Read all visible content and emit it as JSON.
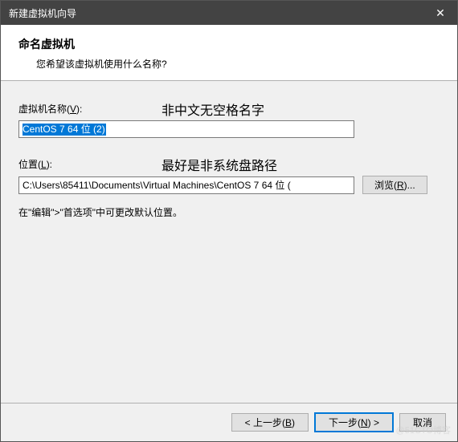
{
  "window": {
    "title": "新建虚拟机向导"
  },
  "header": {
    "title": "命名虚拟机",
    "subtitle": "您希望该虚拟机使用什么名称?"
  },
  "nameField": {
    "label_pre": "虚拟机名称(",
    "label_key": "V",
    "label_post": "):",
    "value": "CentOS 7 64 位 (2)",
    "annotation": "非中文无空格名字"
  },
  "locationField": {
    "label_pre": "位置(",
    "label_key": "L",
    "label_post": "):",
    "value": "C:\\Users\\85411\\Documents\\Virtual Machines\\CentOS 7 64 位 (",
    "annotation": "最好是非系统盘路径",
    "browse_pre": "浏览(",
    "browse_key": "R",
    "browse_post": ")..."
  },
  "note": "在\"编辑\">\"首选项\"中可更改默认位置。",
  "footer": {
    "back_pre": "< 上一步(",
    "back_key": "B",
    "back_post": ")",
    "next_pre": "下一步(",
    "next_key": "N",
    "next_post": ") >",
    "cancel": "取消"
  },
  "watermark": "@51CTO博客"
}
